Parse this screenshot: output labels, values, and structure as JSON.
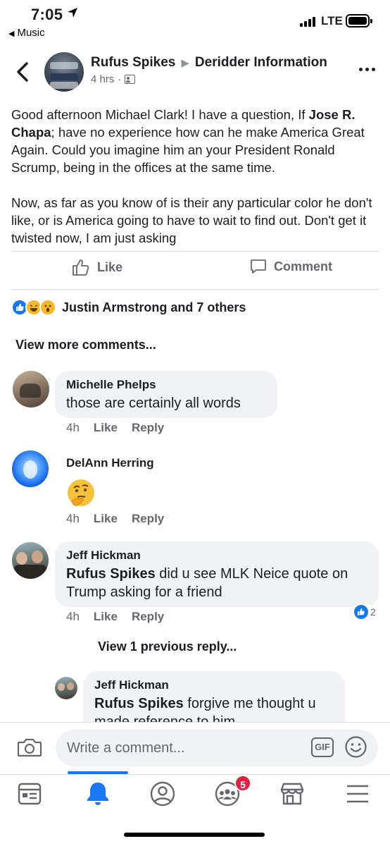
{
  "status_bar": {
    "time": "7:05",
    "back_app": "Music",
    "network": "LTE"
  },
  "post": {
    "author": "Rufus Spikes",
    "group": "Deridder Information",
    "time": "4 hrs",
    "separator": "·",
    "paragraph1_before": "Good afternoon Michael Clark! I have a question, If ",
    "paragraph1_tag": "Jose R. Chapa",
    "paragraph1_after": "; have no experience how can he make America Great Again. Could you imagine him an your President Ronald Scrump, being in the offices at the same time.",
    "paragraph2": "Now, as far as you know of is their any particular color he don't like, or is America going to have to wait to find out. Don't get it twisted now, I am just asking",
    "like_label": "Like",
    "comment_label": "Comment",
    "reactions_text": "Justin Armstrong and 7 others",
    "reaction_icons": [
      "like-reaction-icon",
      "haha-reaction-icon",
      "wow-reaction-icon"
    ]
  },
  "comments_section": {
    "view_more": "View more comments...",
    "view_previous_reply": "View 1 previous reply...",
    "comments": [
      {
        "name": "Michelle Phelps",
        "text": "those are certainly all words",
        "time": "4h",
        "like": "Like",
        "reply": "Reply"
      },
      {
        "name": "DelAnn Herring",
        "emoji": "thinking-face-emoji",
        "time": "4h",
        "like": "Like",
        "reply": "Reply"
      },
      {
        "name": "Jeff Hickman",
        "mention": "Rufus Spikes",
        "text": " did u see MLK Neice quote on Trump asking for a friend",
        "time": "4h",
        "like": "Like",
        "reply": "Reply",
        "like_count": "2"
      },
      {
        "name": "Jeff Hickman",
        "mention": "Rufus Spikes",
        "text": " forgive me thought u made reference to him"
      }
    ]
  },
  "composer": {
    "placeholder": "Write a comment...",
    "gif_label": "GIF"
  },
  "tab_bar": {
    "items": [
      "news-feed-icon",
      "notifications-bell-icon",
      "profile-icon",
      "groups-icon",
      "marketplace-icon",
      "menu-icon"
    ],
    "active": "notifications-bell-icon",
    "groups_badge": "5"
  },
  "colors": {
    "accent": "#1877f2",
    "text": "#1c1e21",
    "muted": "#65676b",
    "bubble": "#f0f2f5",
    "badge": "#e41e3f"
  }
}
